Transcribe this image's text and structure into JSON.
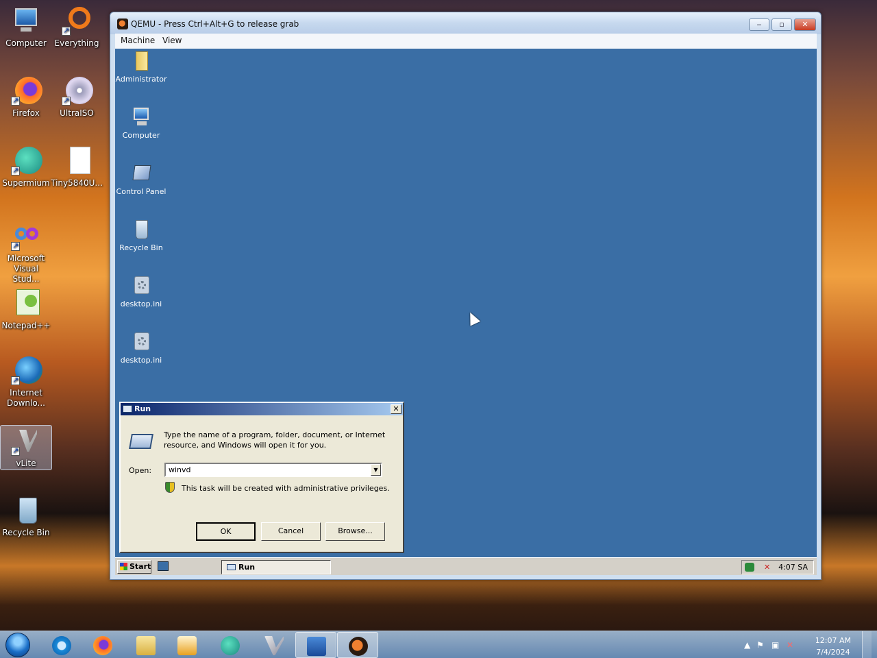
{
  "host_desktop": {
    "icons": [
      {
        "label": "Computer",
        "icon": "computer-icon"
      },
      {
        "label": "Everything",
        "icon": "everything-icon"
      },
      {
        "label": "Firefox",
        "icon": "firefox-icon"
      },
      {
        "label": "UltraISO",
        "icon": "ultraiso-icon"
      },
      {
        "label": "Supermium",
        "icon": "supermium-icon"
      },
      {
        "label": "Tiny5840U...",
        "icon": "file-icon"
      },
      {
        "label": "Microsoft Visual Stud...",
        "icon": "visual-studio-icon"
      },
      {
        "label": "Notepad++",
        "icon": "notepad-plus-plus-icon"
      },
      {
        "label": "Internet Downlo...",
        "icon": "internet-download-manager-icon"
      },
      {
        "label": "vLite",
        "icon": "vlite-icon"
      },
      {
        "label": "Recycle Bin",
        "icon": "recycle-bin-icon"
      }
    ]
  },
  "qemu": {
    "title": "QEMU - Press Ctrl+Alt+G to release grab",
    "menu": [
      "Machine",
      "View"
    ],
    "buttons": {
      "minimize": "‒",
      "restore": "▫",
      "close": "✕"
    }
  },
  "guest": {
    "icons": [
      {
        "label": "Administrator",
        "icon": "folder-icon"
      },
      {
        "label": "Computer",
        "icon": "computer-icon"
      },
      {
        "label": "Control Panel",
        "icon": "control-panel-icon"
      },
      {
        "label": "Recycle Bin",
        "icon": "recycle-bin-icon"
      },
      {
        "label": "desktop.ini",
        "icon": "settings-file-icon"
      },
      {
        "label": "desktop.ini",
        "icon": "settings-file-icon"
      }
    ],
    "run_dialog": {
      "title": "Run",
      "description": "Type the name of a program, folder, document, or Internet resource, and Windows will open it for you.",
      "open_label": "Open:",
      "open_value": "winvd",
      "admin_note": "This task will be created with administrative privileges.",
      "buttons": {
        "ok": "OK",
        "cancel": "Cancel",
        "browse": "Browse..."
      }
    },
    "taskbar": {
      "start_label": "Start",
      "task_label": "Run",
      "clock": "4:07 SA"
    }
  },
  "host_taskbar": {
    "pinned": [
      "internet-explorer-icon",
      "firefox-icon",
      "file-explorer-icon",
      "media-player-icon",
      "supermium-icon",
      "vlite-icon",
      "powershell-icon",
      "qemu-icon"
    ],
    "clock_time": "12:07 AM",
    "clock_date": "7/4/2024"
  }
}
